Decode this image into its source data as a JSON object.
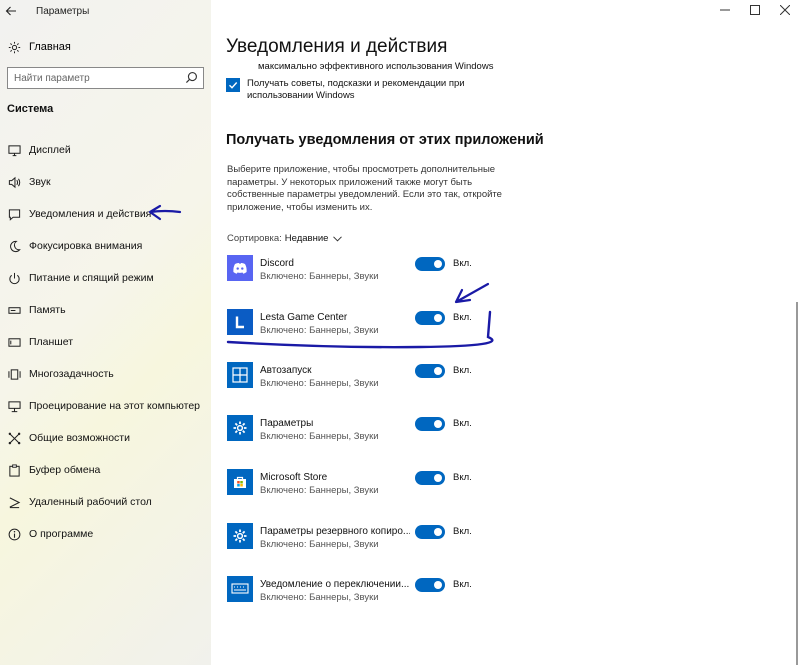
{
  "window": {
    "title": "Параметры"
  },
  "sidebar": {
    "home_label": "Главная",
    "search_placeholder": "Найти параметр",
    "section_title": "Система",
    "items": [
      {
        "label": "Дисплей",
        "icon": "display-icon"
      },
      {
        "label": "Звук",
        "icon": "speaker-icon"
      },
      {
        "label": "Уведомления и действия",
        "icon": "notification-icon"
      },
      {
        "label": "Фокусировка внимания",
        "icon": "moon-icon"
      },
      {
        "label": "Питание и спящий режим",
        "icon": "power-icon"
      },
      {
        "label": "Память",
        "icon": "storage-icon"
      },
      {
        "label": "Планшет",
        "icon": "tablet-icon"
      },
      {
        "label": "Многозадачность",
        "icon": "multitasking-icon"
      },
      {
        "label": "Проецирование на этот компьютер",
        "icon": "projecting-icon"
      },
      {
        "label": "Общие возможности",
        "icon": "shared-experiences-icon"
      },
      {
        "label": "Буфер обмена",
        "icon": "clipboard-icon"
      },
      {
        "label": "Удаленный рабочий стол",
        "icon": "remote-desktop-icon"
      },
      {
        "label": "О программе",
        "icon": "info-icon"
      }
    ]
  },
  "main": {
    "title": "Уведомления и действия",
    "cut_text": "максимально эффективного использования Windows",
    "tips_checkbox": {
      "checked": true,
      "label": "Получать советы, подсказки и рекомендации при использовании Windows"
    },
    "apps_heading": "Получать уведомления от этих приложений",
    "description": "Выберите приложение, чтобы просмотреть дополнительные параметры. У некоторых приложений также могут быть собственные параметры уведомлений. Если это так, откройте приложение, чтобы изменить их.",
    "sort_label": "Сортировка:",
    "sort_value": "Недавние",
    "apps": [
      {
        "name": "Discord",
        "status": "Включено: Баннеры, Звуки",
        "toggle": "Вкл.",
        "on": true,
        "icon": "discord-icon",
        "color": "#5865f2"
      },
      {
        "name": "Lesta Game Center",
        "status": "Включено: Баннеры, Звуки",
        "toggle": "Вкл.",
        "on": true,
        "icon": "lesta-icon",
        "color": "#0b5cc4"
      },
      {
        "name": "Автозапуск",
        "status": "Включено: Баннеры, Звуки",
        "toggle": "Вкл.",
        "on": true,
        "icon": "autoplay-icon",
        "color": "#0067c0"
      },
      {
        "name": "Параметры",
        "status": "Включено: Баннеры, Звуки",
        "toggle": "Вкл.",
        "on": true,
        "icon": "settings-gear-icon",
        "color": "#0067c0"
      },
      {
        "name": "Microsoft Store",
        "status": "Включено: Баннеры, Звуки",
        "toggle": "Вкл.",
        "on": true,
        "icon": "store-icon",
        "color": "#0067c0"
      },
      {
        "name": "Параметры резервного копиро...",
        "status": "Включено: Баннеры, Звуки",
        "toggle": "Вкл.",
        "on": true,
        "icon": "backup-settings-icon",
        "color": "#0067c0"
      },
      {
        "name": "Уведомление о переключении...",
        "status": "Включено: Баннеры, Звуки",
        "toggle": "Вкл.",
        "on": true,
        "icon": "keyboard-switch-icon",
        "color": "#0067c0"
      }
    ]
  },
  "colors": {
    "accent": "#0067c0",
    "annotation": "#1a1aa6"
  }
}
